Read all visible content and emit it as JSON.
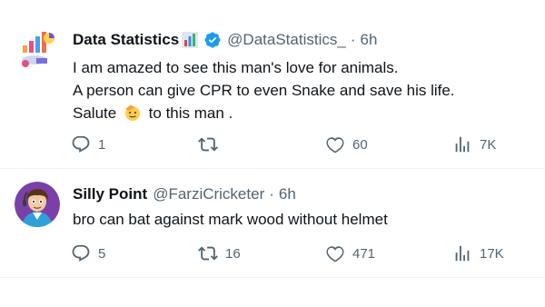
{
  "tweets": [
    {
      "author_name": "Data Statistics",
      "name_emoji": "bar-chart-emoji",
      "verified": true,
      "handle": "@DataStatistics_",
      "separator": "·",
      "time": "6h",
      "lines": [
        "I am amazed to see this man's love for animals.",
        "A person can give CPR to even Snake and save his life.",
        {
          "before": "Salute",
          "emoji": "saluting-face-emoji",
          "after": "to this man ."
        }
      ],
      "replies": "1",
      "retweets": "",
      "likes": "60",
      "views": "7K"
    },
    {
      "author_name": "Silly Point",
      "verified": false,
      "handle": "@FarziCricketer",
      "separator": "·",
      "time": "6h",
      "lines": [
        "bro can bat against mark wood without helmet"
      ],
      "replies": "5",
      "retweets": "16",
      "likes": "471",
      "views": "17K"
    }
  ],
  "colors": {
    "text": "#0f1419",
    "secondary": "#536471",
    "verified_blue": "#1d9bf0",
    "divider": "#eff3f4"
  },
  "icons": [
    "reply-icon",
    "retweet-icon",
    "like-icon",
    "views-icon",
    "verified-badge-icon"
  ]
}
